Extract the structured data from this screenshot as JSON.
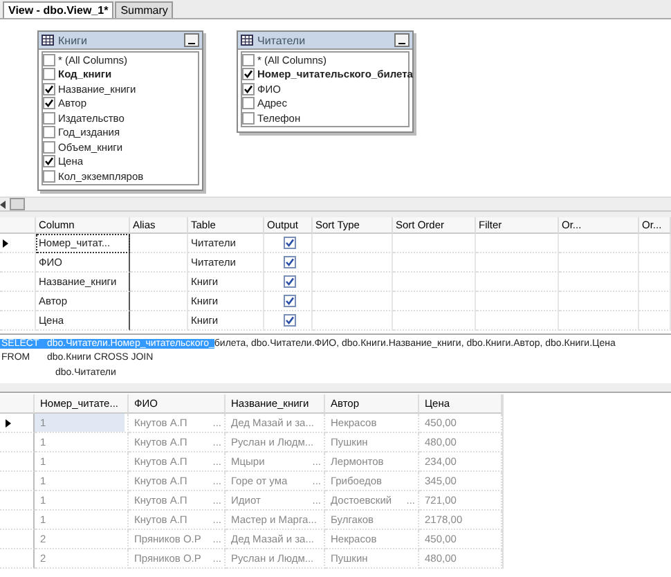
{
  "tabs": [
    {
      "label": "View - dbo.View_1*",
      "selected": true
    },
    {
      "label": "Summary",
      "selected": false
    }
  ],
  "diagram": {
    "tables": [
      {
        "title": "Книги",
        "columns": [
          {
            "label": "* (All Columns)",
            "checked": false,
            "key": false
          },
          {
            "label": "Код_книги",
            "checked": false,
            "key": true
          },
          {
            "label": "Название_книги",
            "checked": true,
            "key": false
          },
          {
            "label": "Автор",
            "checked": true,
            "key": false
          },
          {
            "label": "Издательство",
            "checked": false,
            "key": false
          },
          {
            "label": "Год_издания",
            "checked": false,
            "key": false
          },
          {
            "label": "Объем_книги",
            "checked": false,
            "key": false
          },
          {
            "label": "Цена",
            "checked": true,
            "key": false
          },
          {
            "label": "Кол_экземпляров",
            "checked": false,
            "key": false
          }
        ]
      },
      {
        "title": "Читатели",
        "columns": [
          {
            "label": "* (All Columns)",
            "checked": false,
            "key": false
          },
          {
            "label": "Номер_читательского_билета",
            "checked": true,
            "key": true
          },
          {
            "label": "ФИО",
            "checked": true,
            "key": false
          },
          {
            "label": "Адрес",
            "checked": false,
            "key": false
          },
          {
            "label": "Телефон",
            "checked": false,
            "key": false
          }
        ]
      }
    ]
  },
  "criteria": {
    "columns": [
      "Column",
      "Alias",
      "Table",
      "Output",
      "Sort Type",
      "Sort Order",
      "Filter",
      "Or...",
      "Or..."
    ],
    "rows": [
      {
        "column": "Номер_читат...",
        "table": "Читатели",
        "output": true,
        "current": true
      },
      {
        "column": "ФИО",
        "table": "Читатели",
        "output": true,
        "current": false
      },
      {
        "column": "Название_книги",
        "table": "Книги",
        "output": true,
        "current": false
      },
      {
        "column": "Автор",
        "table": "Книги",
        "output": true,
        "current": false
      },
      {
        "column": "Цена",
        "table": "Книги",
        "output": true,
        "current": false
      }
    ]
  },
  "sql": {
    "lines": [
      {
        "keyword": "SELECT",
        "selected_text": "dbo.Читатели.Номер_читательского_",
        "text": "билета, dbo.Читатели.ФИО, dbo.Книги.Название_книги, dbo.Книги.Автор, dbo.Книги.Цена"
      },
      {
        "keyword": "FROM",
        "text": "dbo.Книги CROSS JOIN"
      },
      {
        "text": "dbo.Читатели"
      }
    ]
  },
  "results": {
    "columns": [
      "Номер_читате...",
      "ФИО",
      "Название_книги",
      "Автор",
      "Цена"
    ],
    "rows": [
      {
        "current": true,
        "cells": [
          {
            "text": "1",
            "selected": true
          },
          {
            "text": "Кнутов А.П",
            "more": "..."
          },
          {
            "text": "Дед Мазай и за..."
          },
          {
            "text": "Некрасов"
          },
          {
            "text": "450,00"
          }
        ]
      },
      {
        "current": false,
        "cells": [
          {
            "text": "1",
            "selected": false
          },
          {
            "text": "Кнутов А.П",
            "more": "..."
          },
          {
            "text": "Руслан и Людм..."
          },
          {
            "text": "Пушкин"
          },
          {
            "text": "480,00"
          }
        ]
      },
      {
        "current": false,
        "cells": [
          {
            "text": "1",
            "selected": false
          },
          {
            "text": "Кнутов А.П",
            "more": "..."
          },
          {
            "text": "Мцыри",
            "more": "..."
          },
          {
            "text": "Лермонтов"
          },
          {
            "text": "234,00"
          }
        ]
      },
      {
        "current": false,
        "cells": [
          {
            "text": "1",
            "selected": false
          },
          {
            "text": "Кнутов А.П",
            "more": "..."
          },
          {
            "text": "Горе от ума",
            "more": "..."
          },
          {
            "text": "Грибоедов"
          },
          {
            "text": "345,00"
          }
        ]
      },
      {
        "current": false,
        "cells": [
          {
            "text": "1",
            "selected": false
          },
          {
            "text": "Кнутов А.П",
            "more": "..."
          },
          {
            "text": "Идиот",
            "more": "..."
          },
          {
            "text": "Достоевский",
            "more": "..."
          },
          {
            "text": "721,00"
          }
        ]
      },
      {
        "current": false,
        "cells": [
          {
            "text": "1",
            "selected": false
          },
          {
            "text": "Кнутов А.П",
            "more": "..."
          },
          {
            "text": "Мастер и Марга..."
          },
          {
            "text": "Булгаков"
          },
          {
            "text": "2178,00"
          }
        ]
      },
      {
        "current": false,
        "cells": [
          {
            "text": "2",
            "selected": false
          },
          {
            "text": "Пряников О.Р",
            "more": "..."
          },
          {
            "text": "Дед Мазай и за..."
          },
          {
            "text": "Некрасов"
          },
          {
            "text": "450,00"
          }
        ]
      },
      {
        "current": false,
        "cells": [
          {
            "text": "2",
            "selected": false
          },
          {
            "text": "Пряников О.Р",
            "more": "..."
          },
          {
            "text": "Руслан и Людм..."
          },
          {
            "text": "Пушкин"
          },
          {
            "text": "480,00"
          }
        ]
      }
    ]
  }
}
